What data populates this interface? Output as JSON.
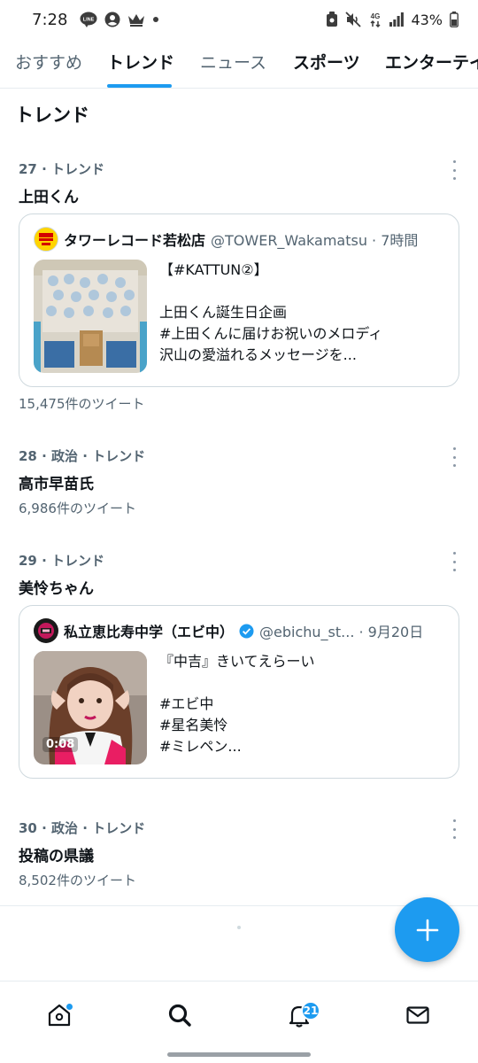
{
  "status_bar": {
    "time": "7:28",
    "left_icons": [
      "line-icon",
      "account-circle-icon",
      "crown-icon",
      "dot-icon"
    ],
    "right_icons": [
      "nfc-lock-icon",
      "mute-icon",
      "4g-icon",
      "signal-icon",
      "battery-icon"
    ],
    "network": "4G",
    "battery": "43%"
  },
  "tabs": [
    {
      "label": "おすすめ",
      "active": false
    },
    {
      "label": "トレンド",
      "active": true
    },
    {
      "label": "ニュース",
      "active": false
    },
    {
      "label": "スポーツ",
      "active": false
    },
    {
      "label": "エンターテイ",
      "active": false
    }
  ],
  "section_title": "トレンド",
  "trends": [
    {
      "meta": "27 · トレンド",
      "name": "上田くん",
      "count": "15,475件のツイート",
      "tweet": {
        "author": "タワーレコード若松店",
        "handle": "@TOWER_Wakamatsu · 7時間",
        "lines": [
          "【#KATTUN②】",
          "",
          "上田くん誕生日企画",
          "#上田くんに届けお祝いのメロディ",
          "沢山の愛溢れるメッセージを..."
        ]
      }
    },
    {
      "meta": "28 · 政治 · トレンド",
      "name": "高市早苗氏",
      "count": "6,986件のツイート"
    },
    {
      "meta": "29 · トレンド",
      "name": "美怜ちゃん",
      "tweet": {
        "author": "私立恵比寿中学（エビ中）",
        "handle": "@ebichu_st... · 9月20日",
        "lines": [
          "『中吉』きいてえらーい",
          "",
          "#エビ中",
          "#星名美怜",
          "#ミレペン..."
        ],
        "video_duration": "0:08"
      }
    },
    {
      "meta": "30 · 政治 · トレンド",
      "name": "投稿の県議",
      "count": "8,502件のツイート"
    }
  ],
  "fab": {
    "icon": "plus-icon"
  },
  "bottom_nav": {
    "items": [
      "home-icon",
      "search-icon",
      "bell-icon",
      "mail-icon"
    ],
    "notification_count": "21"
  },
  "colors": {
    "accent": "#1d9bf0",
    "text": "#0f1419",
    "secondary": "#536471",
    "border": "#cfd9de"
  }
}
